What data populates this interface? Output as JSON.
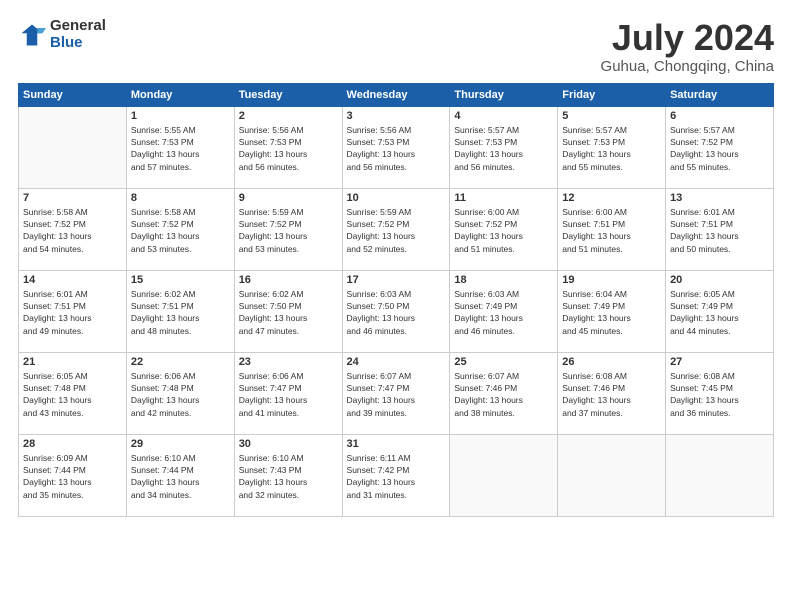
{
  "logo": {
    "general": "General",
    "blue": "Blue"
  },
  "header": {
    "month": "July 2024",
    "location": "Guhua, Chongqing, China"
  },
  "weekdays": [
    "Sunday",
    "Monday",
    "Tuesday",
    "Wednesday",
    "Thursday",
    "Friday",
    "Saturday"
  ],
  "weeks": [
    [
      {
        "day": "",
        "info": ""
      },
      {
        "day": "1",
        "info": "Sunrise: 5:55 AM\nSunset: 7:53 PM\nDaylight: 13 hours\nand 57 minutes."
      },
      {
        "day": "2",
        "info": "Sunrise: 5:56 AM\nSunset: 7:53 PM\nDaylight: 13 hours\nand 56 minutes."
      },
      {
        "day": "3",
        "info": "Sunrise: 5:56 AM\nSunset: 7:53 PM\nDaylight: 13 hours\nand 56 minutes."
      },
      {
        "day": "4",
        "info": "Sunrise: 5:57 AM\nSunset: 7:53 PM\nDaylight: 13 hours\nand 56 minutes."
      },
      {
        "day": "5",
        "info": "Sunrise: 5:57 AM\nSunset: 7:53 PM\nDaylight: 13 hours\nand 55 minutes."
      },
      {
        "day": "6",
        "info": "Sunrise: 5:57 AM\nSunset: 7:52 PM\nDaylight: 13 hours\nand 55 minutes."
      }
    ],
    [
      {
        "day": "7",
        "info": "Sunrise: 5:58 AM\nSunset: 7:52 PM\nDaylight: 13 hours\nand 54 minutes."
      },
      {
        "day": "8",
        "info": "Sunrise: 5:58 AM\nSunset: 7:52 PM\nDaylight: 13 hours\nand 53 minutes."
      },
      {
        "day": "9",
        "info": "Sunrise: 5:59 AM\nSunset: 7:52 PM\nDaylight: 13 hours\nand 53 minutes."
      },
      {
        "day": "10",
        "info": "Sunrise: 5:59 AM\nSunset: 7:52 PM\nDaylight: 13 hours\nand 52 minutes."
      },
      {
        "day": "11",
        "info": "Sunrise: 6:00 AM\nSunset: 7:52 PM\nDaylight: 13 hours\nand 51 minutes."
      },
      {
        "day": "12",
        "info": "Sunrise: 6:00 AM\nSunset: 7:51 PM\nDaylight: 13 hours\nand 51 minutes."
      },
      {
        "day": "13",
        "info": "Sunrise: 6:01 AM\nSunset: 7:51 PM\nDaylight: 13 hours\nand 50 minutes."
      }
    ],
    [
      {
        "day": "14",
        "info": "Sunrise: 6:01 AM\nSunset: 7:51 PM\nDaylight: 13 hours\nand 49 minutes."
      },
      {
        "day": "15",
        "info": "Sunrise: 6:02 AM\nSunset: 7:51 PM\nDaylight: 13 hours\nand 48 minutes."
      },
      {
        "day": "16",
        "info": "Sunrise: 6:02 AM\nSunset: 7:50 PM\nDaylight: 13 hours\nand 47 minutes."
      },
      {
        "day": "17",
        "info": "Sunrise: 6:03 AM\nSunset: 7:50 PM\nDaylight: 13 hours\nand 46 minutes."
      },
      {
        "day": "18",
        "info": "Sunrise: 6:03 AM\nSunset: 7:49 PM\nDaylight: 13 hours\nand 46 minutes."
      },
      {
        "day": "19",
        "info": "Sunrise: 6:04 AM\nSunset: 7:49 PM\nDaylight: 13 hours\nand 45 minutes."
      },
      {
        "day": "20",
        "info": "Sunrise: 6:05 AM\nSunset: 7:49 PM\nDaylight: 13 hours\nand 44 minutes."
      }
    ],
    [
      {
        "day": "21",
        "info": "Sunrise: 6:05 AM\nSunset: 7:48 PM\nDaylight: 13 hours\nand 43 minutes."
      },
      {
        "day": "22",
        "info": "Sunrise: 6:06 AM\nSunset: 7:48 PM\nDaylight: 13 hours\nand 42 minutes."
      },
      {
        "day": "23",
        "info": "Sunrise: 6:06 AM\nSunset: 7:47 PM\nDaylight: 13 hours\nand 41 minutes."
      },
      {
        "day": "24",
        "info": "Sunrise: 6:07 AM\nSunset: 7:47 PM\nDaylight: 13 hours\nand 39 minutes."
      },
      {
        "day": "25",
        "info": "Sunrise: 6:07 AM\nSunset: 7:46 PM\nDaylight: 13 hours\nand 38 minutes."
      },
      {
        "day": "26",
        "info": "Sunrise: 6:08 AM\nSunset: 7:46 PM\nDaylight: 13 hours\nand 37 minutes."
      },
      {
        "day": "27",
        "info": "Sunrise: 6:08 AM\nSunset: 7:45 PM\nDaylight: 13 hours\nand 36 minutes."
      }
    ],
    [
      {
        "day": "28",
        "info": "Sunrise: 6:09 AM\nSunset: 7:44 PM\nDaylight: 13 hours\nand 35 minutes."
      },
      {
        "day": "29",
        "info": "Sunrise: 6:10 AM\nSunset: 7:44 PM\nDaylight: 13 hours\nand 34 minutes."
      },
      {
        "day": "30",
        "info": "Sunrise: 6:10 AM\nSunset: 7:43 PM\nDaylight: 13 hours\nand 32 minutes."
      },
      {
        "day": "31",
        "info": "Sunrise: 6:11 AM\nSunset: 7:42 PM\nDaylight: 13 hours\nand 31 minutes."
      },
      {
        "day": "",
        "info": ""
      },
      {
        "day": "",
        "info": ""
      },
      {
        "day": "",
        "info": ""
      }
    ]
  ]
}
